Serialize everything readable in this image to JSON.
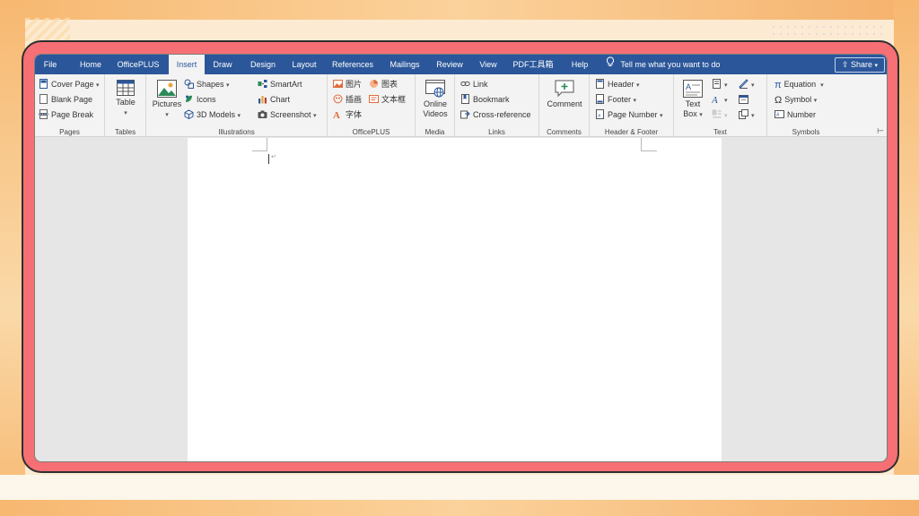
{
  "tabs": [
    {
      "label": "File"
    },
    {
      "label": "Home"
    },
    {
      "label": "OfficePLUS"
    },
    {
      "label": "Insert"
    },
    {
      "label": "Draw"
    },
    {
      "label": "Design"
    },
    {
      "label": "Layout"
    },
    {
      "label": "References"
    },
    {
      "label": "Mailings"
    },
    {
      "label": "Review"
    },
    {
      "label": "View"
    },
    {
      "label": "PDF工具箱"
    },
    {
      "label": "Help"
    }
  ],
  "active_tab": "Insert",
  "tell_me": "Tell me what you want to do",
  "share": "Share",
  "groups": {
    "pages": {
      "label": "Pages",
      "cover_page": "Cover Page",
      "blank_page": "Blank Page",
      "page_break": "Page Break"
    },
    "tables": {
      "label": "Tables",
      "table": "Table"
    },
    "illustrations": {
      "label": "Illustrations",
      "pictures": "Pictures",
      "shapes": "Shapes",
      "icons": "Icons",
      "models_3d": "3D Models",
      "smartart": "SmartArt",
      "chart": "Chart",
      "screenshot": "Screenshot"
    },
    "officeplus": {
      "label": "OfficePLUS",
      "picture": "图片",
      "chart": "图表",
      "illustration": "插画",
      "textbox": "文本框",
      "font": "字体"
    },
    "media": {
      "label": "Media",
      "online_videos_line1": "Online",
      "online_videos_line2": "Videos"
    },
    "links": {
      "label": "Links",
      "link": "Link",
      "bookmark": "Bookmark",
      "cross_reference": "Cross-reference"
    },
    "comments": {
      "label": "Comments",
      "comment": "Comment"
    },
    "header_footer": {
      "label": "Header & Footer",
      "header": "Header",
      "footer": "Footer",
      "page_number": "Page Number"
    },
    "text": {
      "label": "Text",
      "text_box_line1": "Text",
      "text_box_line2": "Box"
    },
    "symbols": {
      "label": "Symbols",
      "equation": "Equation",
      "symbol": "Symbol",
      "number": "Number"
    }
  },
  "colors": {
    "ribbon_blue": "#2b579a",
    "frame_red": "#f56f74",
    "frame_orange": "#f7b871"
  }
}
